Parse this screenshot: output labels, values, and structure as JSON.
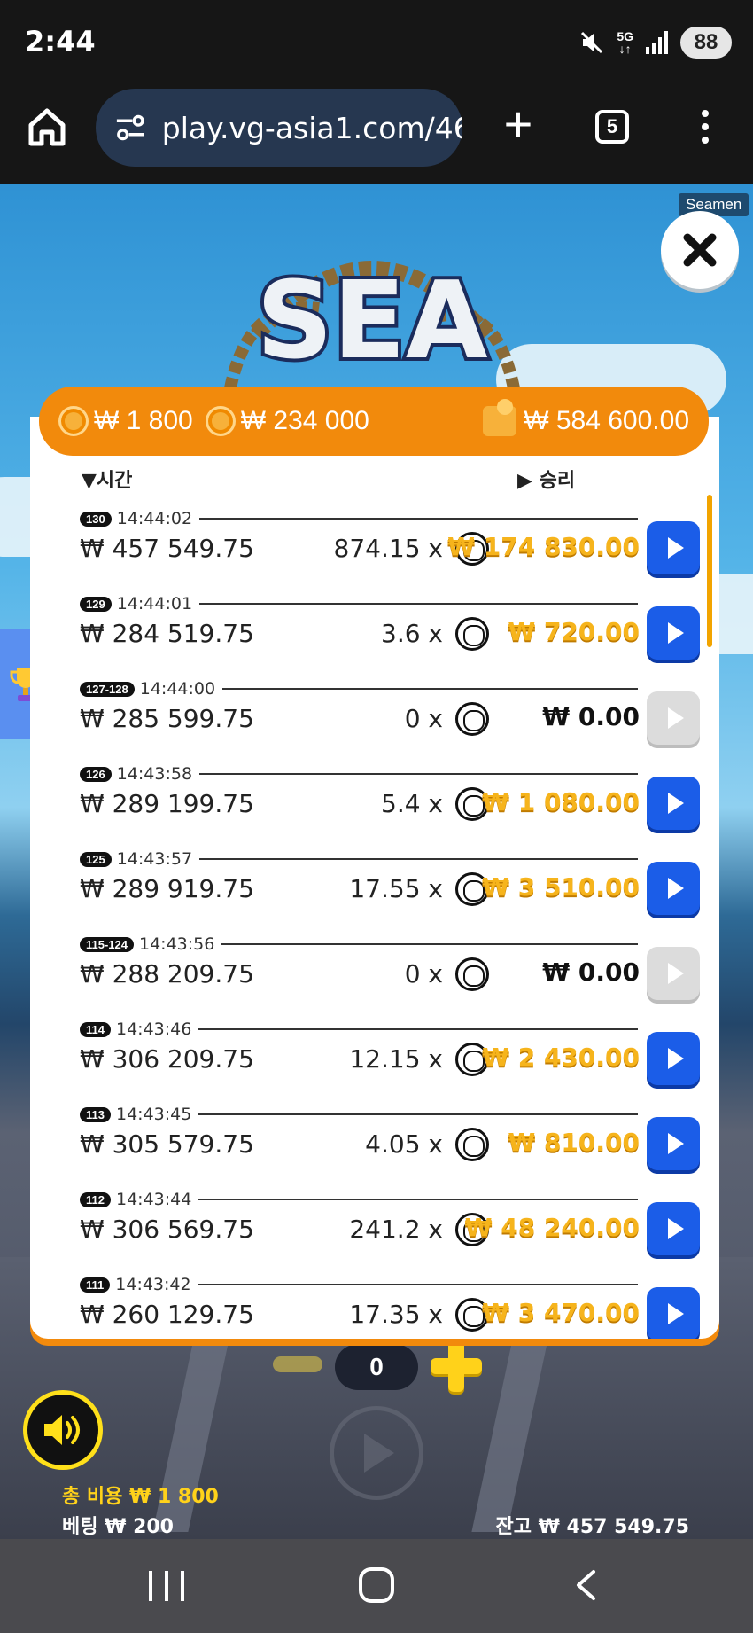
{
  "status": {
    "time": "2:44",
    "network": "5G",
    "battery": "88"
  },
  "browser": {
    "url": "play.vg-asia1.com/46",
    "tab_count": "5"
  },
  "game": {
    "tag": "Seamen",
    "logo_text": "SEA",
    "header": {
      "total_cost": "₩ 1 800",
      "max_win": "₩ 234 000",
      "balance": "₩ 584 600.00"
    },
    "columns": {
      "time": "▼시간",
      "win": "▶ 승리"
    },
    "rows": [
      {
        "round": "130",
        "time": "14:44:02",
        "balance": "₩ 457 549.75",
        "multiplier": "874.15 x",
        "win": "₩ 174 830.00",
        "replay_enabled": true
      },
      {
        "round": "129",
        "time": "14:44:01",
        "balance": "₩ 284 519.75",
        "multiplier": "3.6 x",
        "win": "₩ 720.00",
        "replay_enabled": true
      },
      {
        "round": "127-128",
        "time": "14:44:00",
        "balance": "₩ 285 599.75",
        "multiplier": "0 x",
        "win": "₩ 0.00",
        "replay_enabled": false
      },
      {
        "round": "126",
        "time": "14:43:58",
        "balance": "₩ 289 199.75",
        "multiplier": "5.4 x",
        "win": "₩ 1 080.00",
        "replay_enabled": true
      },
      {
        "round": "125",
        "time": "14:43:57",
        "balance": "₩ 289 919.75",
        "multiplier": "17.55 x",
        "win": "₩ 3 510.00",
        "replay_enabled": true
      },
      {
        "round": "115-124",
        "time": "14:43:56",
        "balance": "₩ 288 209.75",
        "multiplier": "0 x",
        "win": "₩ 0.00",
        "replay_enabled": false
      },
      {
        "round": "114",
        "time": "14:43:46",
        "balance": "₩ 306 209.75",
        "multiplier": "12.15 x",
        "win": "₩ 2 430.00",
        "replay_enabled": true
      },
      {
        "round": "113",
        "time": "14:43:45",
        "balance": "₩ 305 579.75",
        "multiplier": "4.05 x",
        "win": "₩ 810.00",
        "replay_enabled": true
      },
      {
        "round": "112",
        "time": "14:43:44",
        "balance": "₩ 306 569.75",
        "multiplier": "241.2 x",
        "win": "₩ 48 240.00",
        "replay_enabled": true
      },
      {
        "round": "111",
        "time": "14:43:42",
        "balance": "₩ 260 129.75",
        "multiplier": "17.35 x",
        "win": "₩ 3 470.00",
        "replay_enabled": true
      }
    ],
    "controls": {
      "bet_count": "0",
      "total_cost_label": "총 비용 ₩ 1 800",
      "bet_label": "베팅 ₩ 200",
      "balance_label": "잔고 ₩ 457 549.75"
    }
  },
  "colors": {
    "orange": "#f28a0c",
    "gold": "#f6b41c",
    "replay_blue": "#1b5de8",
    "url_pill": "#263750"
  }
}
